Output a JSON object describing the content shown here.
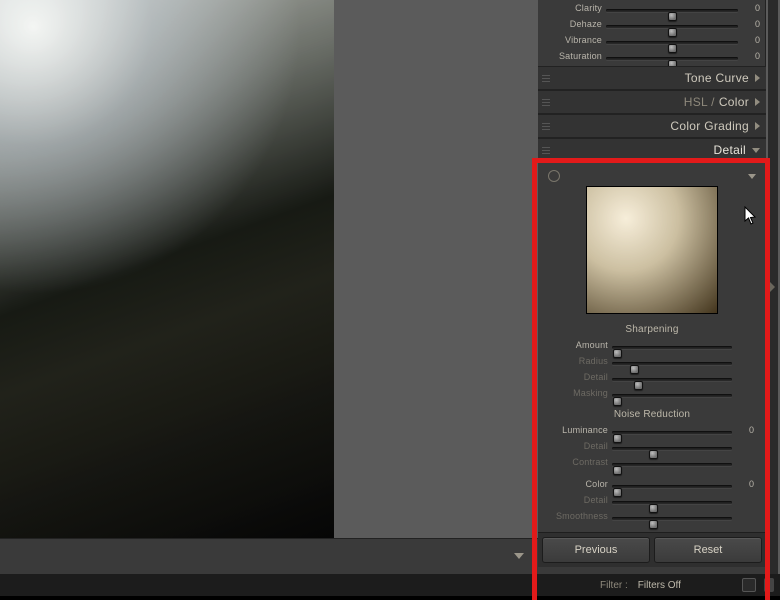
{
  "basic": {
    "clarity": {
      "label": "Clarity",
      "value": "0",
      "pos": 50
    },
    "dehaze": {
      "label": "Dehaze",
      "value": "0",
      "pos": 50
    },
    "vibrance": {
      "label": "Vibrance",
      "value": "0",
      "pos": 50
    },
    "saturation": {
      "label": "Saturation",
      "value": "0",
      "pos": 50
    }
  },
  "sections": {
    "tone_curve": "Tone Curve",
    "hsl_prefix": "HSL /",
    "color": "Color",
    "color_grading": "Color Grading",
    "detail": "Detail"
  },
  "detail": {
    "sharpening_header": "Sharpening",
    "sharpening": {
      "amount": {
        "label": "Amount",
        "value": "",
        "pos": 4
      },
      "radius": {
        "label": "Radius",
        "value": "",
        "pos": 18
      },
      "detail": {
        "label": "Detail",
        "value": "",
        "pos": 22
      },
      "masking": {
        "label": "Masking",
        "value": "",
        "pos": 4
      }
    },
    "noise_header": "Noise Reduction",
    "noise": {
      "luminance": {
        "label": "Luminance",
        "value": "0",
        "pos": 4
      },
      "lum_detail": {
        "label": "Detail",
        "value": "",
        "pos": 34
      },
      "contrast": {
        "label": "Contrast",
        "value": "",
        "pos": 4
      },
      "color": {
        "label": "Color",
        "value": "0",
        "pos": 4
      },
      "col_detail": {
        "label": "Detail",
        "value": "",
        "pos": 34
      },
      "smoothness": {
        "label": "Smoothness",
        "value": "",
        "pos": 34
      }
    }
  },
  "buttons": {
    "previous": "Previous",
    "reset": "Reset"
  },
  "filter": {
    "label": "Filter :",
    "status": "Filters Off"
  }
}
